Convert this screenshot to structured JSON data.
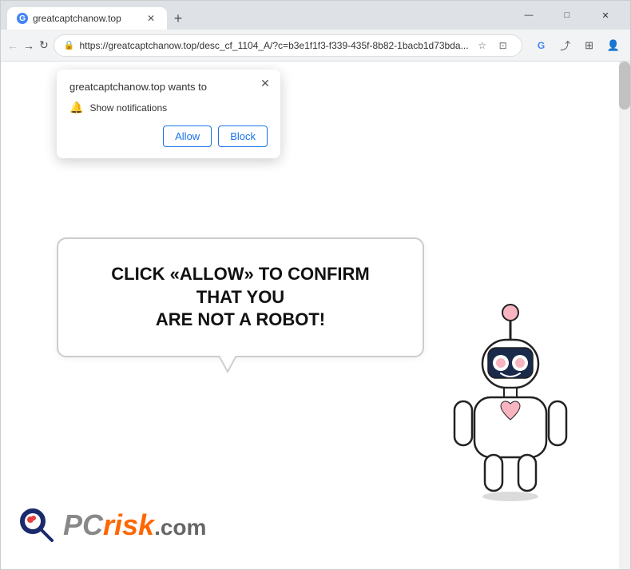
{
  "browser": {
    "tab_title": "greatcaptchanow.top",
    "url": "https://greatcaptchanow.top/desc_cf_1104_A/?c=b3e1f1f3-f339-435f-8b82-1bacb1d73bda...",
    "nav": {
      "back_label": "←",
      "forward_label": "→",
      "refresh_label": "↻"
    },
    "window_controls": {
      "minimize": "—",
      "maximize": "□",
      "close": "✕"
    }
  },
  "popup": {
    "title": "greatcaptchanow.top wants to",
    "notification_label": "Show notifications",
    "close_label": "✕",
    "allow_label": "Allow",
    "block_label": "Block"
  },
  "main": {
    "speech_bubble_line1": "CLICK «ALLOW» TO CONFIRM THAT YOU",
    "speech_bubble_line2": "ARE NOT A ROBOT!"
  },
  "logo": {
    "pc_text": "PC",
    "risk_text": "risk",
    "com_text": ".com"
  },
  "colors": {
    "allow_btn": "#1a73e8",
    "block_btn": "#1a73e8",
    "risk_orange": "#ff6600"
  }
}
